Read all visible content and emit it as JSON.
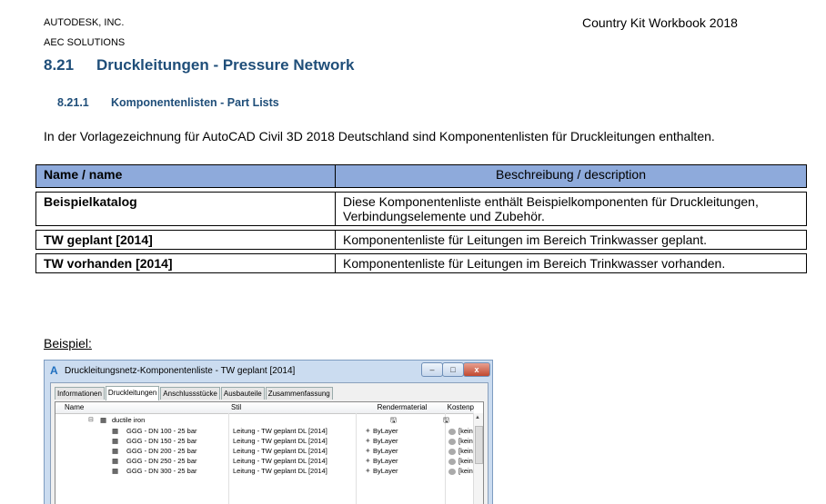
{
  "header": {
    "company": "AUTODESK, INC.",
    "division": "AEC SOLUTIONS",
    "workbook": "Country Kit Workbook 2018"
  },
  "section": {
    "number": "8.21",
    "title": "Druckleitungen - Pressure Network"
  },
  "subsection": {
    "number": "8.21.1",
    "title": "Komponentenlisten - Part Lists"
  },
  "intro": "In der Vorlagezeichnung für AutoCAD Civil 3D 2018 Deutschland sind Komponentenlisten für Druckleitungen enthalten.",
  "table": {
    "headers": [
      "Name / name",
      "Beschreibung / description"
    ],
    "rows": [
      {
        "name": "Beispielkatalog",
        "desc": "Diese Komponentenliste enthält Beispielkomponenten für Druckleitungen, Verbindungselemente und Zubehör."
      },
      {
        "name": "TW geplant [2014]",
        "desc": "Komponentenliste für Leitungen im Bereich Trinkwasser geplant."
      },
      {
        "name": "TW vorhanden [2014]",
        "desc": "Komponentenliste für Leitungen im Bereich Trinkwasser vorhanden."
      }
    ]
  },
  "example_label": "Beispiel:",
  "dialog": {
    "title": "Druckleitungsnetz-Komponentenliste - TW geplant [2014]",
    "tabs": [
      "Informationen",
      "Druckleitungen",
      "Anschlussstücke",
      "Ausbauteile",
      "Zusammenfassung"
    ],
    "active_tab": 1,
    "columns": {
      "name": "Name",
      "stil": "Stil",
      "render": "Rendermaterial",
      "kosten": "Kostenp"
    },
    "group": "ductile iron",
    "parts": [
      {
        "name": "GGG - DN 100 - 25 bar",
        "stil": "Leitung - TW geplant DL [2014]",
        "render": "ByLayer",
        "kosten": "[kein"
      },
      {
        "name": "GGG - DN 150 - 25 bar",
        "stil": "Leitung - TW geplant DL [2014]",
        "render": "ByLayer",
        "kosten": "[kein"
      },
      {
        "name": "GGG - DN 200 - 25 bar",
        "stil": "Leitung - TW geplant DL [2014]",
        "render": "ByLayer",
        "kosten": "[kein"
      },
      {
        "name": "GGG - DN 250 - 25 bar",
        "stil": "Leitung - TW geplant DL [2014]",
        "render": "ByLayer",
        "kosten": "[kein"
      },
      {
        "name": "GGG - DN 300 - 25 bar",
        "stil": "Leitung - TW geplant DL [2014]",
        "render": "ByLayer",
        "kosten": "[kein"
      }
    ]
  }
}
